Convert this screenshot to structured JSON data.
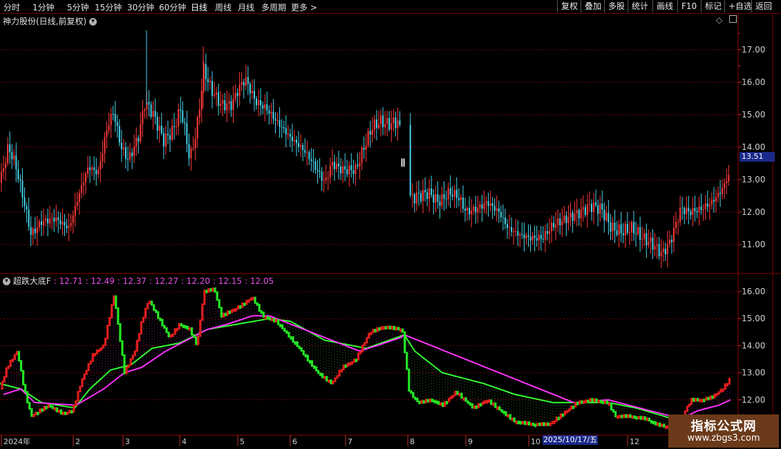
{
  "toolbar": {
    "periods": [
      "分时",
      "1分钟",
      "5分钟",
      "15分钟",
      "30分钟",
      "60分钟",
      "日线",
      "周线",
      "月线",
      "多周期",
      "更多 >"
    ],
    "active_period": "日线",
    "right_buttons": [
      "复权",
      "叠加",
      "多股",
      "统计",
      "画线",
      "F10",
      "标记",
      "+自选",
      "返回"
    ]
  },
  "main_panel": {
    "title": "神力股份(日线,前复权)",
    "current_price_tag": "13.51",
    "y_ticks": [
      "17.00",
      "16.00",
      "15.00",
      "14.00",
      "13.00",
      "12.00",
      "11.00"
    ]
  },
  "indicator_panel": {
    "title": "超跌大底F",
    "values": [
      "12.71",
      "12.49",
      "12.37",
      "12.27",
      "12.20",
      "12.15",
      "12.05"
    ],
    "y_ticks": [
      "16.00",
      "15.00",
      "14.00",
      "13.00",
      "12.00"
    ]
  },
  "x_axis": {
    "labels": [
      "2024年",
      "2",
      "3",
      "4",
      "5",
      "6",
      "7",
      "8",
      "9",
      "10",
      "12"
    ],
    "cursor_date": "2025/10/17/五"
  },
  "watermark": {
    "title": "指标公式网",
    "url": "www.zbgs3.com"
  },
  "colors": {
    "up": "#ff3b3b",
    "down": "#45d7ee",
    "ind_up": "#e11d1d",
    "ind_down": "#23e623",
    "line_green": "#33ff33",
    "line_magenta": "#ff33ff",
    "grid": "#7a0000",
    "tag_bg": "#1a2a8a"
  },
  "chart_data": {
    "type": "candlestick",
    "title": "神力股份(日线,前复权)",
    "price_range": [
      10.2,
      18.1
    ],
    "path_points": [
      [
        0,
        12.9
      ],
      [
        12,
        14.0
      ],
      [
        22,
        13.5
      ],
      [
        35,
        12.3
      ],
      [
        45,
        11.3
      ],
      [
        60,
        11.7
      ],
      [
        80,
        11.8
      ],
      [
        100,
        11.5
      ],
      [
        115,
        12.6
      ],
      [
        128,
        13.4
      ],
      [
        142,
        13.2
      ],
      [
        155,
        14.6
      ],
      [
        164,
        15.1
      ],
      [
        175,
        14.0
      ],
      [
        186,
        13.6
      ],
      [
        200,
        14.3
      ],
      [
        210,
        15.4
      ],
      [
        222,
        15.0
      ],
      [
        237,
        14.2
      ],
      [
        250,
        14.5
      ],
      [
        262,
        15.2
      ],
      [
        275,
        13.6
      ],
      [
        285,
        14.6
      ],
      [
        295,
        16.4
      ],
      [
        305,
        15.8
      ],
      [
        320,
        15.3
      ],
      [
        335,
        15.3
      ],
      [
        345,
        15.8
      ],
      [
        355,
        16.1
      ],
      [
        370,
        15.4
      ],
      [
        385,
        15.2
      ],
      [
        400,
        14.8
      ],
      [
        420,
        14.3
      ],
      [
        440,
        13.9
      ],
      [
        450,
        13.6
      ],
      [
        470,
        12.9
      ],
      [
        480,
        13.5
      ],
      [
        495,
        13.3
      ],
      [
        515,
        13.3
      ],
      [
        525,
        13.9
      ],
      [
        538,
        14.6
      ],
      [
        550,
        14.8
      ],
      [
        562,
        14.7
      ],
      [
        577,
        14.8
      ],
      [
        590,
        12.4
      ],
      [
        605,
        12.5
      ],
      [
        620,
        12.6
      ],
      [
        635,
        12.3
      ],
      [
        650,
        12.6
      ],
      [
        662,
        12.5
      ],
      [
        675,
        12.0
      ],
      [
        690,
        12.1
      ],
      [
        705,
        12.3
      ],
      [
        722,
        12.0
      ],
      [
        735,
        11.5
      ],
      [
        752,
        11.3
      ],
      [
        768,
        11.2
      ],
      [
        785,
        11.2
      ],
      [
        800,
        11.6
      ],
      [
        820,
        11.8
      ],
      [
        840,
        12.0
      ],
      [
        855,
        12.2
      ],
      [
        870,
        12.1
      ],
      [
        885,
        11.5
      ],
      [
        900,
        11.4
      ],
      [
        915,
        11.5
      ],
      [
        930,
        11.2
      ],
      [
        945,
        11.0
      ],
      [
        958,
        10.7
      ],
      [
        970,
        11.1
      ],
      [
        985,
        12.1
      ],
      [
        998,
        12.0
      ],
      [
        1015,
        12.1
      ],
      [
        1030,
        12.3
      ],
      [
        1045,
        12.7
      ],
      [
        1053,
        13.1
      ]
    ],
    "gap_x": [
      580,
      592
    ],
    "indicator": {
      "name": "超跌大底F",
      "stair_points": [
        [
          0,
          12.4
        ],
        [
          10,
          13.2
        ],
        [
          25,
          13.8
        ],
        [
          35,
          12.4
        ],
        [
          45,
          11.4
        ],
        [
          70,
          11.8
        ],
        [
          90,
          11.5
        ],
        [
          105,
          11.6
        ],
        [
          118,
          12.7
        ],
        [
          135,
          13.7
        ],
        [
          150,
          14.0
        ],
        [
          165,
          15.9
        ],
        [
          180,
          13.0
        ],
        [
          195,
          13.8
        ],
        [
          205,
          14.9
        ],
        [
          215,
          15.7
        ],
        [
          230,
          15.0
        ],
        [
          245,
          14.3
        ],
        [
          260,
          14.8
        ],
        [
          275,
          14.6
        ],
        [
          285,
          14.0
        ],
        [
          295,
          16.0
        ],
        [
          310,
          16.1
        ],
        [
          320,
          15.1
        ],
        [
          335,
          15.3
        ],
        [
          350,
          15.5
        ],
        [
          365,
          15.8
        ],
        [
          380,
          15.1
        ],
        [
          400,
          14.9
        ],
        [
          430,
          14.0
        ],
        [
          460,
          13.0
        ],
        [
          480,
          12.6
        ],
        [
          495,
          13.2
        ],
        [
          515,
          13.5
        ],
        [
          535,
          14.5
        ],
        [
          555,
          14.7
        ],
        [
          582,
          14.6
        ],
        [
          592,
          12.3
        ],
        [
          605,
          11.9
        ],
        [
          625,
          12.0
        ],
        [
          640,
          11.8
        ],
        [
          660,
          12.3
        ],
        [
          685,
          11.7
        ],
        [
          705,
          12.0
        ],
        [
          725,
          11.6
        ],
        [
          745,
          11.2
        ],
        [
          770,
          11.1
        ],
        [
          795,
          11.1
        ],
        [
          815,
          11.5
        ],
        [
          835,
          11.9
        ],
        [
          855,
          12.0
        ],
        [
          880,
          11.9
        ],
        [
          890,
          11.4
        ],
        [
          910,
          11.4
        ],
        [
          935,
          11.3
        ],
        [
          950,
          11.1
        ],
        [
          965,
          11.0
        ],
        [
          985,
          11.3
        ],
        [
          1000,
          12.0
        ],
        [
          1015,
          12.0
        ],
        [
          1030,
          12.1
        ],
        [
          1045,
          12.4
        ],
        [
          1057,
          12.8
        ]
      ],
      "green_line": [
        [
          0,
          12.6
        ],
        [
          30,
          12.4
        ],
        [
          60,
          11.9
        ],
        [
          108,
          11.7
        ],
        [
          130,
          12.4
        ],
        [
          160,
          13.1
        ],
        [
          190,
          13.3
        ],
        [
          220,
          13.9
        ],
        [
          260,
          14.1
        ],
        [
          300,
          14.6
        ],
        [
          345,
          14.8
        ],
        [
          390,
          15.0
        ],
        [
          420,
          14.9
        ],
        [
          470,
          14.2
        ],
        [
          530,
          13.9
        ],
        [
          585,
          14.4
        ],
        [
          600,
          13.8
        ],
        [
          640,
          13.0
        ],
        [
          700,
          12.6
        ],
        [
          745,
          12.2
        ],
        [
          800,
          11.9
        ],
        [
          830,
          11.9
        ],
        [
          880,
          11.9
        ],
        [
          920,
          11.7
        ],
        [
          960,
          11.4
        ],
        [
          985,
          11.2
        ]
      ],
      "magenta_line": [
        [
          5,
          12.2
        ],
        [
          30,
          12.4
        ],
        [
          50,
          11.9
        ],
        [
          110,
          11.8
        ],
        [
          150,
          12.4
        ],
        [
          180,
          13.0
        ],
        [
          205,
          13.2
        ],
        [
          240,
          13.8
        ],
        [
          270,
          14.2
        ],
        [
          300,
          14.6
        ],
        [
          330,
          14.8
        ],
        [
          365,
          15.1
        ],
        [
          390,
          15.1
        ],
        [
          520,
          13.8
        ],
        [
          545,
          14.0
        ],
        [
          580,
          14.3
        ],
        [
          585,
          14.4
        ],
        [
          830,
          11.9
        ],
        [
          880,
          12.0
        ],
        [
          985,
          11.3
        ],
        [
          1010,
          11.6
        ],
        [
          1040,
          11.8
        ],
        [
          1057,
          12.0
        ]
      ]
    }
  }
}
